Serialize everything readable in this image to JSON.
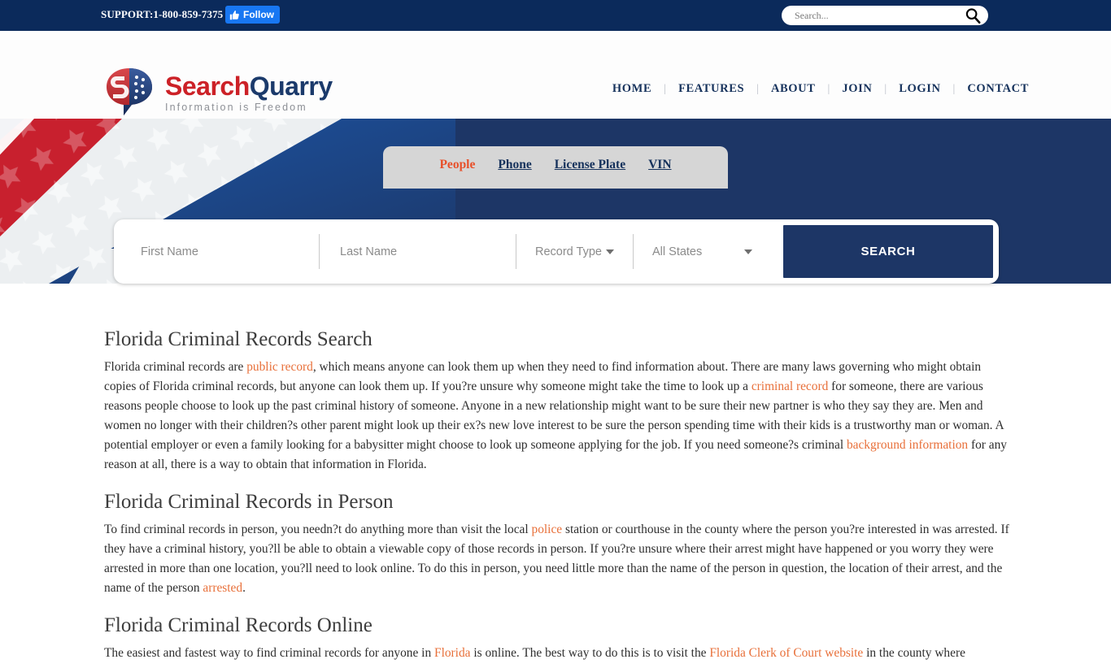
{
  "topbar": {
    "support_label": "SUPPORT:1-800-859-7375",
    "facebook_follow_label": "Follow",
    "facebook_icon": "thumbs-up-icon",
    "search_placeholder": "Search...",
    "search_value": "",
    "search_icon": "magnifier-icon",
    "bar_color": "#0b2a5b",
    "facebook_color": "#1877f2"
  },
  "header": {
    "logo": {
      "word_one": "Search",
      "word_two": "Quarry",
      "tagline": "Information is Freedom",
      "icon": "searchquarry-logo-icon",
      "red": "#cc2127",
      "blue": "#1b3a6b"
    },
    "nav": [
      {
        "label": "HOME"
      },
      {
        "label": "FEATURES"
      },
      {
        "label": "ABOUT"
      },
      {
        "label": "JOIN"
      },
      {
        "label": "LOGIN"
      },
      {
        "label": "CONTACT"
      }
    ],
    "nav_separator": "|",
    "page_title": "Florida Criminal Records"
  },
  "hero": {
    "background_color": "#1d3666",
    "tabs": [
      {
        "label": "People",
        "active": true
      },
      {
        "label": "Phone",
        "active": false
      },
      {
        "label": "License Plate",
        "active": false
      },
      {
        "label": "VIN",
        "active": false
      }
    ],
    "form": {
      "first_name_placeholder": "First Name",
      "first_name_value": "",
      "last_name_placeholder": "Last Name",
      "last_name_value": "",
      "record_type_label": "Record Type",
      "state_label": "All States",
      "search_button_label": "SEARCH",
      "caret_icon": "chevron-down-icon",
      "button_color": "#1d3666"
    }
  },
  "main": {
    "section1": {
      "heading": "Florida Criminal Records Search",
      "p1_a": "Florida criminal records are ",
      "p1_link1": "public record",
      "p1_b": ", which means anyone can look them up when they need to find information about. There are many laws governing who might obtain copies of Florida criminal records, but anyone can look them up. If you?re unsure why someone might take the time to look up a ",
      "p1_link2": "criminal record",
      "p1_c": " for someone, there are various reasons people choose to look up the past criminal history of someone. Anyone in a new relationship might want to be sure their new partner is who they say they are. Men and women no longer with their children?s other parent might look up their ex?s new love interest to be sure the person spending time with their kids is a trustworthy man or woman. A potential employer or even a family looking for a babysitter might choose to look up someone applying for the job. If you need someone?s criminal ",
      "p1_link3": "background information",
      "p1_d": " for any reason at all, there is a way to obtain that information in Florida."
    },
    "section2": {
      "heading": "Florida Criminal Records in Person",
      "p1_a": "To find criminal records in person, you needn?t do anything more than visit the local ",
      "p1_link1": "police",
      "p1_b": " station or courthouse in the county where the person you?re interested in was arrested. If they have a criminal history, you?ll be able to obtain a viewable copy of those records in person. If you?re unsure where their arrest might have happened or you worry they were arrested in more than one location, you?ll need to look online. To do this in person, you need little more than the name of the person in question, the location of their arrest, and the name of the person ",
      "p1_link2": "arrested",
      "p1_c": "."
    },
    "section3": {
      "heading": "Florida Criminal Records Online",
      "p1_a": "The easiest and fastest way to find criminal records for anyone in ",
      "p1_link1": "Florida",
      "p1_b": " is online. The best way to do this is to visit the ",
      "p1_link2": "Florida Clerk of Court website",
      "p1_c": " in the county where"
    }
  }
}
